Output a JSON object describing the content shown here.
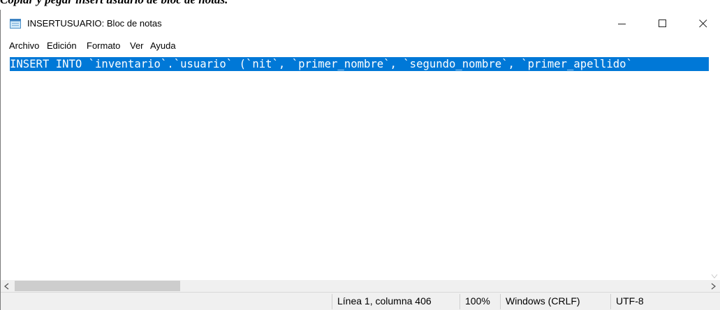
{
  "caption": "Copiar y pegar insert usuario de bloc de notas.",
  "window": {
    "title": "INSERTUSUARIO: Bloc de notas",
    "icon": "notepad-icon"
  },
  "menu": [
    {
      "label": "Archivo"
    },
    {
      "label": "Edición"
    },
    {
      "label": "Formato"
    },
    {
      "label": "Ver"
    },
    {
      "label": "Ayuda"
    }
  ],
  "editor": {
    "text": "INSERT INTO `inventario`.`usuario` (`nit`, `primer_nombre`, `segundo_nombre`, `primer_apellido`"
  },
  "status": {
    "position": "Línea 1, columna 406",
    "zoom": "100%",
    "line_ending": "Windows (CRLF)",
    "encoding": "UTF-8"
  },
  "colors": {
    "selection": "#0078d7",
    "chrome": "#f0f0f0",
    "scroll_thumb": "#cdcdcd"
  }
}
